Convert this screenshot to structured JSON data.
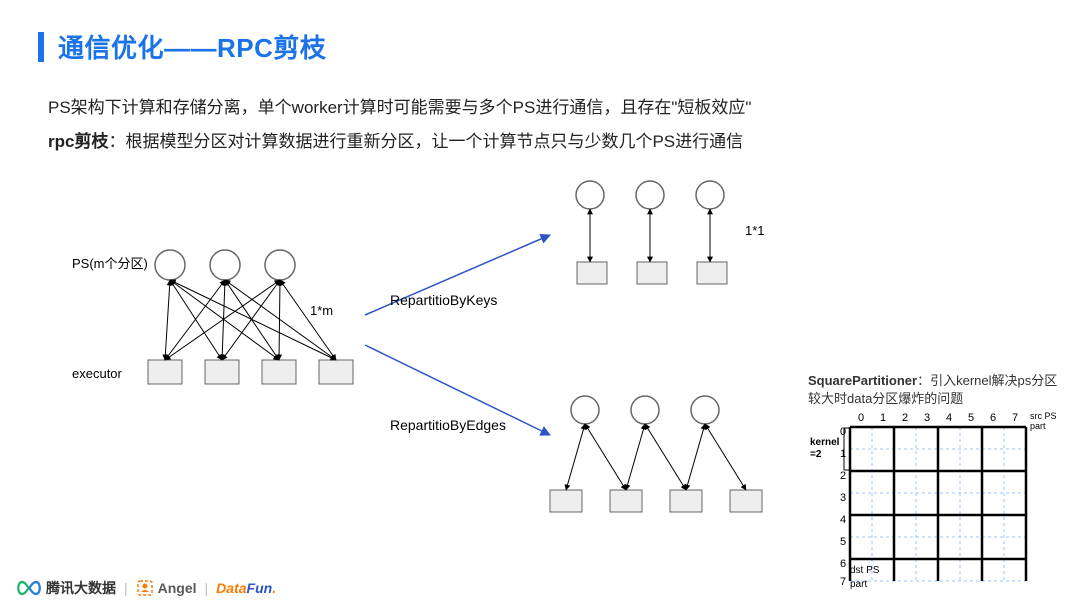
{
  "title": "通信优化——RPC剪枝",
  "desc_line1": "PS架构下计算和存储分离，单个worker计算时可能需要与多个PS进行通信，且存在\"短板效应\"",
  "desc_line2_bold": "rpc剪枝",
  "desc_line2_rest": "：根据模型分区对计算数据进行重新分区，让一个计算节点只与少数几个PS进行通信",
  "left_diag": {
    "ps_label": "PS(m个分区)",
    "exec_label": "executor",
    "one_by_m": "1*m"
  },
  "branches": {
    "by_keys": "RepartitioByKeys",
    "by_edges": "RepartitioByEdges",
    "one_by_one": "1*1"
  },
  "square_partitioner": {
    "title_bold": "SquarePartitioner",
    "title_rest": "：引入kernel解决ps分区较大时data分区爆炸的问题",
    "kernel_label": "kernel\n=2",
    "top_ticks": [
      "0",
      "1",
      "2",
      "3",
      "4",
      "5",
      "6",
      "7"
    ],
    "src_label": "src PS\npart",
    "dst_label": "dst PS\npart"
  },
  "footer": {
    "tencent": "腾讯大数据",
    "angel": "Angel",
    "datafun_a": "Data",
    "datafun_b": "Fun"
  }
}
